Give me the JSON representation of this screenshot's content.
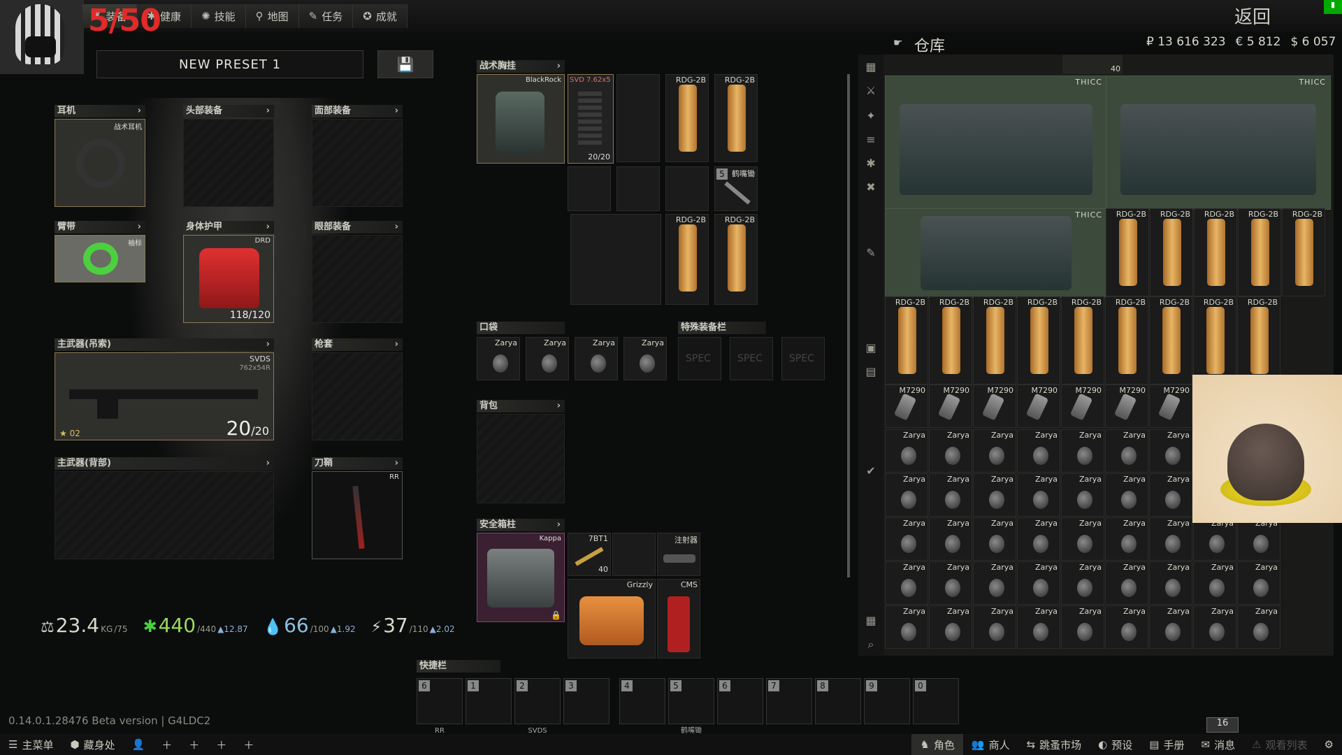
{
  "topbar": {
    "tabs": [
      {
        "icon": "character-icon",
        "label": "装备"
      },
      {
        "icon": "health-icon",
        "label": "健康"
      },
      {
        "icon": "skills-icon",
        "label": "技能"
      },
      {
        "icon": "map-icon",
        "label": "地图"
      },
      {
        "icon": "tasks-icon",
        "label": "任务"
      },
      {
        "icon": "achievements-icon",
        "label": "成就"
      }
    ],
    "overlay_counter": "5/50",
    "back_label": "返回"
  },
  "preset": {
    "name": "NEW PRESET 1"
  },
  "gear": {
    "earpiece": {
      "label": "耳机",
      "item": "战术耳机"
    },
    "headwear": {
      "label": "头部装备"
    },
    "face_cover": {
      "label": "面部装备"
    },
    "armband": {
      "label": "臂带",
      "item": "袖标"
    },
    "body_armor": {
      "label": "身体护甲",
      "item": "DRD",
      "durability": "118/120"
    },
    "eyewear": {
      "label": "眼部装备"
    },
    "primary_sling": {
      "label": "主武器(吊索)",
      "item": "SVDS",
      "caliber": "762x54R",
      "ammo": "20",
      "ammo_max": "/20",
      "level": "02"
    },
    "holster": {
      "label": "枪套"
    },
    "primary_back": {
      "label": "主武器(背部)"
    },
    "scabbard": {
      "label": "刀鞘",
      "item": "RR"
    }
  },
  "rig": {
    "label": "战术胸挂",
    "item": "BlackRock",
    "mag": "SVD 7.62x5",
    "mag_count": "20/20",
    "rdg": "RDG-2B",
    "pic_label": "鹤嘴锄",
    "pic_num": "5"
  },
  "pockets": {
    "label": "口袋",
    "item": "Zarya"
  },
  "special": {
    "label": "特殊装备栏",
    "slot": "SPEC"
  },
  "backpack": {
    "label": "背包"
  },
  "secure": {
    "label": "安全箱柱",
    "container": "Kappa",
    "ammo": "7BT1",
    "ammo_count": "40",
    "injector": "注射器",
    "medkit": "Grizzly",
    "cms": "CMS"
  },
  "stats": {
    "weight": "23.4",
    "weight_unit": "KG",
    "weight_max": "/75",
    "health": "440",
    "health_max": "/440",
    "health_regen": "▲12.87",
    "hydration": "66",
    "hydration_max": "/100",
    "hydration_regen": "▲1.92",
    "energy": "37",
    "energy_max": "/110",
    "energy_regen": "▲2.02"
  },
  "quickbar": {
    "label": "快捷栏",
    "slots": [
      {
        "num": "6",
        "item": "RR"
      },
      {
        "num": "1",
        "item": ""
      },
      {
        "num": "2",
        "item": "SVDS"
      },
      {
        "num": "3",
        "item": ""
      },
      {
        "num": "4",
        "item": ""
      },
      {
        "num": "5",
        "item": "鹤嘴锄"
      },
      {
        "num": "6",
        "item": ""
      },
      {
        "num": "7",
        "item": ""
      },
      {
        "num": "8",
        "item": ""
      },
      {
        "num": "9",
        "item": ""
      },
      {
        "num": "0",
        "item": ""
      }
    ]
  },
  "stash": {
    "title": "仓库",
    "rub": "₽ 13 616 323",
    "eur": "€ 5 812",
    "usd": "$ 6 057",
    "top_count": "40",
    "thicc": "THICC",
    "rdg": "RDG-2B",
    "m7290": "M7290",
    "zarya": "Zarya",
    "level_badge": "16"
  },
  "version": {
    "text": "0.14.0.1.28476 Beta version | G4LDC2"
  },
  "bottombar": {
    "left": [
      {
        "icon": "menu-icon",
        "label": "主菜单"
      },
      {
        "icon": "hideout-icon",
        "label": "藏身处"
      }
    ],
    "right": [
      {
        "icon": "character-icon",
        "label": "角色"
      },
      {
        "icon": "traders-icon",
        "label": "商人"
      },
      {
        "icon": "flea-icon",
        "label": "跳蚤市场"
      },
      {
        "icon": "preset-icon",
        "label": "预设"
      },
      {
        "icon": "handbook-icon",
        "label": "手册"
      },
      {
        "icon": "messages-icon",
        "label": "消息"
      },
      {
        "icon": "watchlist-icon",
        "label": "观看列表"
      }
    ]
  }
}
